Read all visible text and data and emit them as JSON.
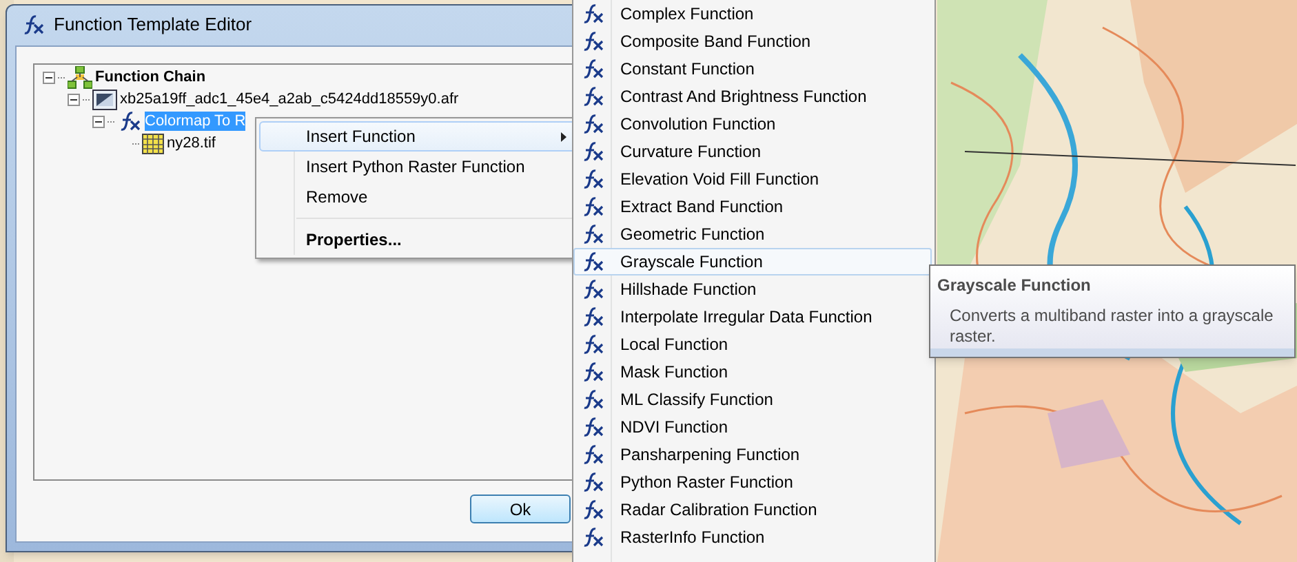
{
  "window": {
    "title": "Function Template Editor"
  },
  "tree": [
    {
      "label": "Function Chain",
      "kind": "chain",
      "bold": true,
      "selected": false,
      "expanded": true,
      "children": [
        {
          "label": "xb25a19ff_adc1_45e4_a2ab_c5424dd18559y0.afr",
          "kind": "dataset",
          "bold": false,
          "selected": false,
          "expanded": true,
          "children": [
            {
              "label": "Colormap To R",
              "kind": "function",
              "bold": false,
              "selected": true,
              "expanded": true,
              "children": [
                {
                  "label": "ny28.tif",
                  "kind": "raster",
                  "bold": false,
                  "selected": false
                }
              ]
            }
          ]
        }
      ]
    }
  ],
  "context_menu": [
    {
      "label": "Insert Function",
      "selected": true,
      "submenu": true,
      "bold": false
    },
    {
      "label": "Insert Python Raster Function",
      "selected": false,
      "submenu": false,
      "bold": false
    },
    {
      "label": "Remove",
      "selected": false,
      "submenu": false,
      "bold": false
    },
    {
      "kind": "separator"
    },
    {
      "label": "Properties...",
      "selected": false,
      "submenu": false,
      "bold": true
    }
  ],
  "ok_button": "Ok",
  "function_menu": [
    {
      "label": "Complex Function",
      "selected": false
    },
    {
      "label": "Composite Band Function",
      "selected": false
    },
    {
      "label": "Constant Function",
      "selected": false
    },
    {
      "label": "Contrast And Brightness Function",
      "selected": false
    },
    {
      "label": "Convolution Function",
      "selected": false
    },
    {
      "label": "Curvature Function",
      "selected": false
    },
    {
      "label": "Elevation Void Fill Function",
      "selected": false
    },
    {
      "label": "Extract Band Function",
      "selected": false
    },
    {
      "label": "Geometric Function",
      "selected": false
    },
    {
      "label": "Grayscale Function",
      "selected": true
    },
    {
      "label": "Hillshade Function",
      "selected": false
    },
    {
      "label": "Interpolate Irregular Data Function",
      "selected": false
    },
    {
      "label": "Local Function",
      "selected": false
    },
    {
      "label": "Mask Function",
      "selected": false
    },
    {
      "label": "ML Classify Function",
      "selected": false
    },
    {
      "label": "NDVI Function",
      "selected": false
    },
    {
      "label": "Pansharpening Function",
      "selected": false
    },
    {
      "label": "Python Raster Function",
      "selected": false
    },
    {
      "label": "Radar Calibration Function",
      "selected": false
    },
    {
      "label": "RasterInfo Function",
      "selected": false
    }
  ],
  "tooltip": {
    "title": "Grayscale Function",
    "text": "Converts a multiband raster into a grayscale raster."
  }
}
